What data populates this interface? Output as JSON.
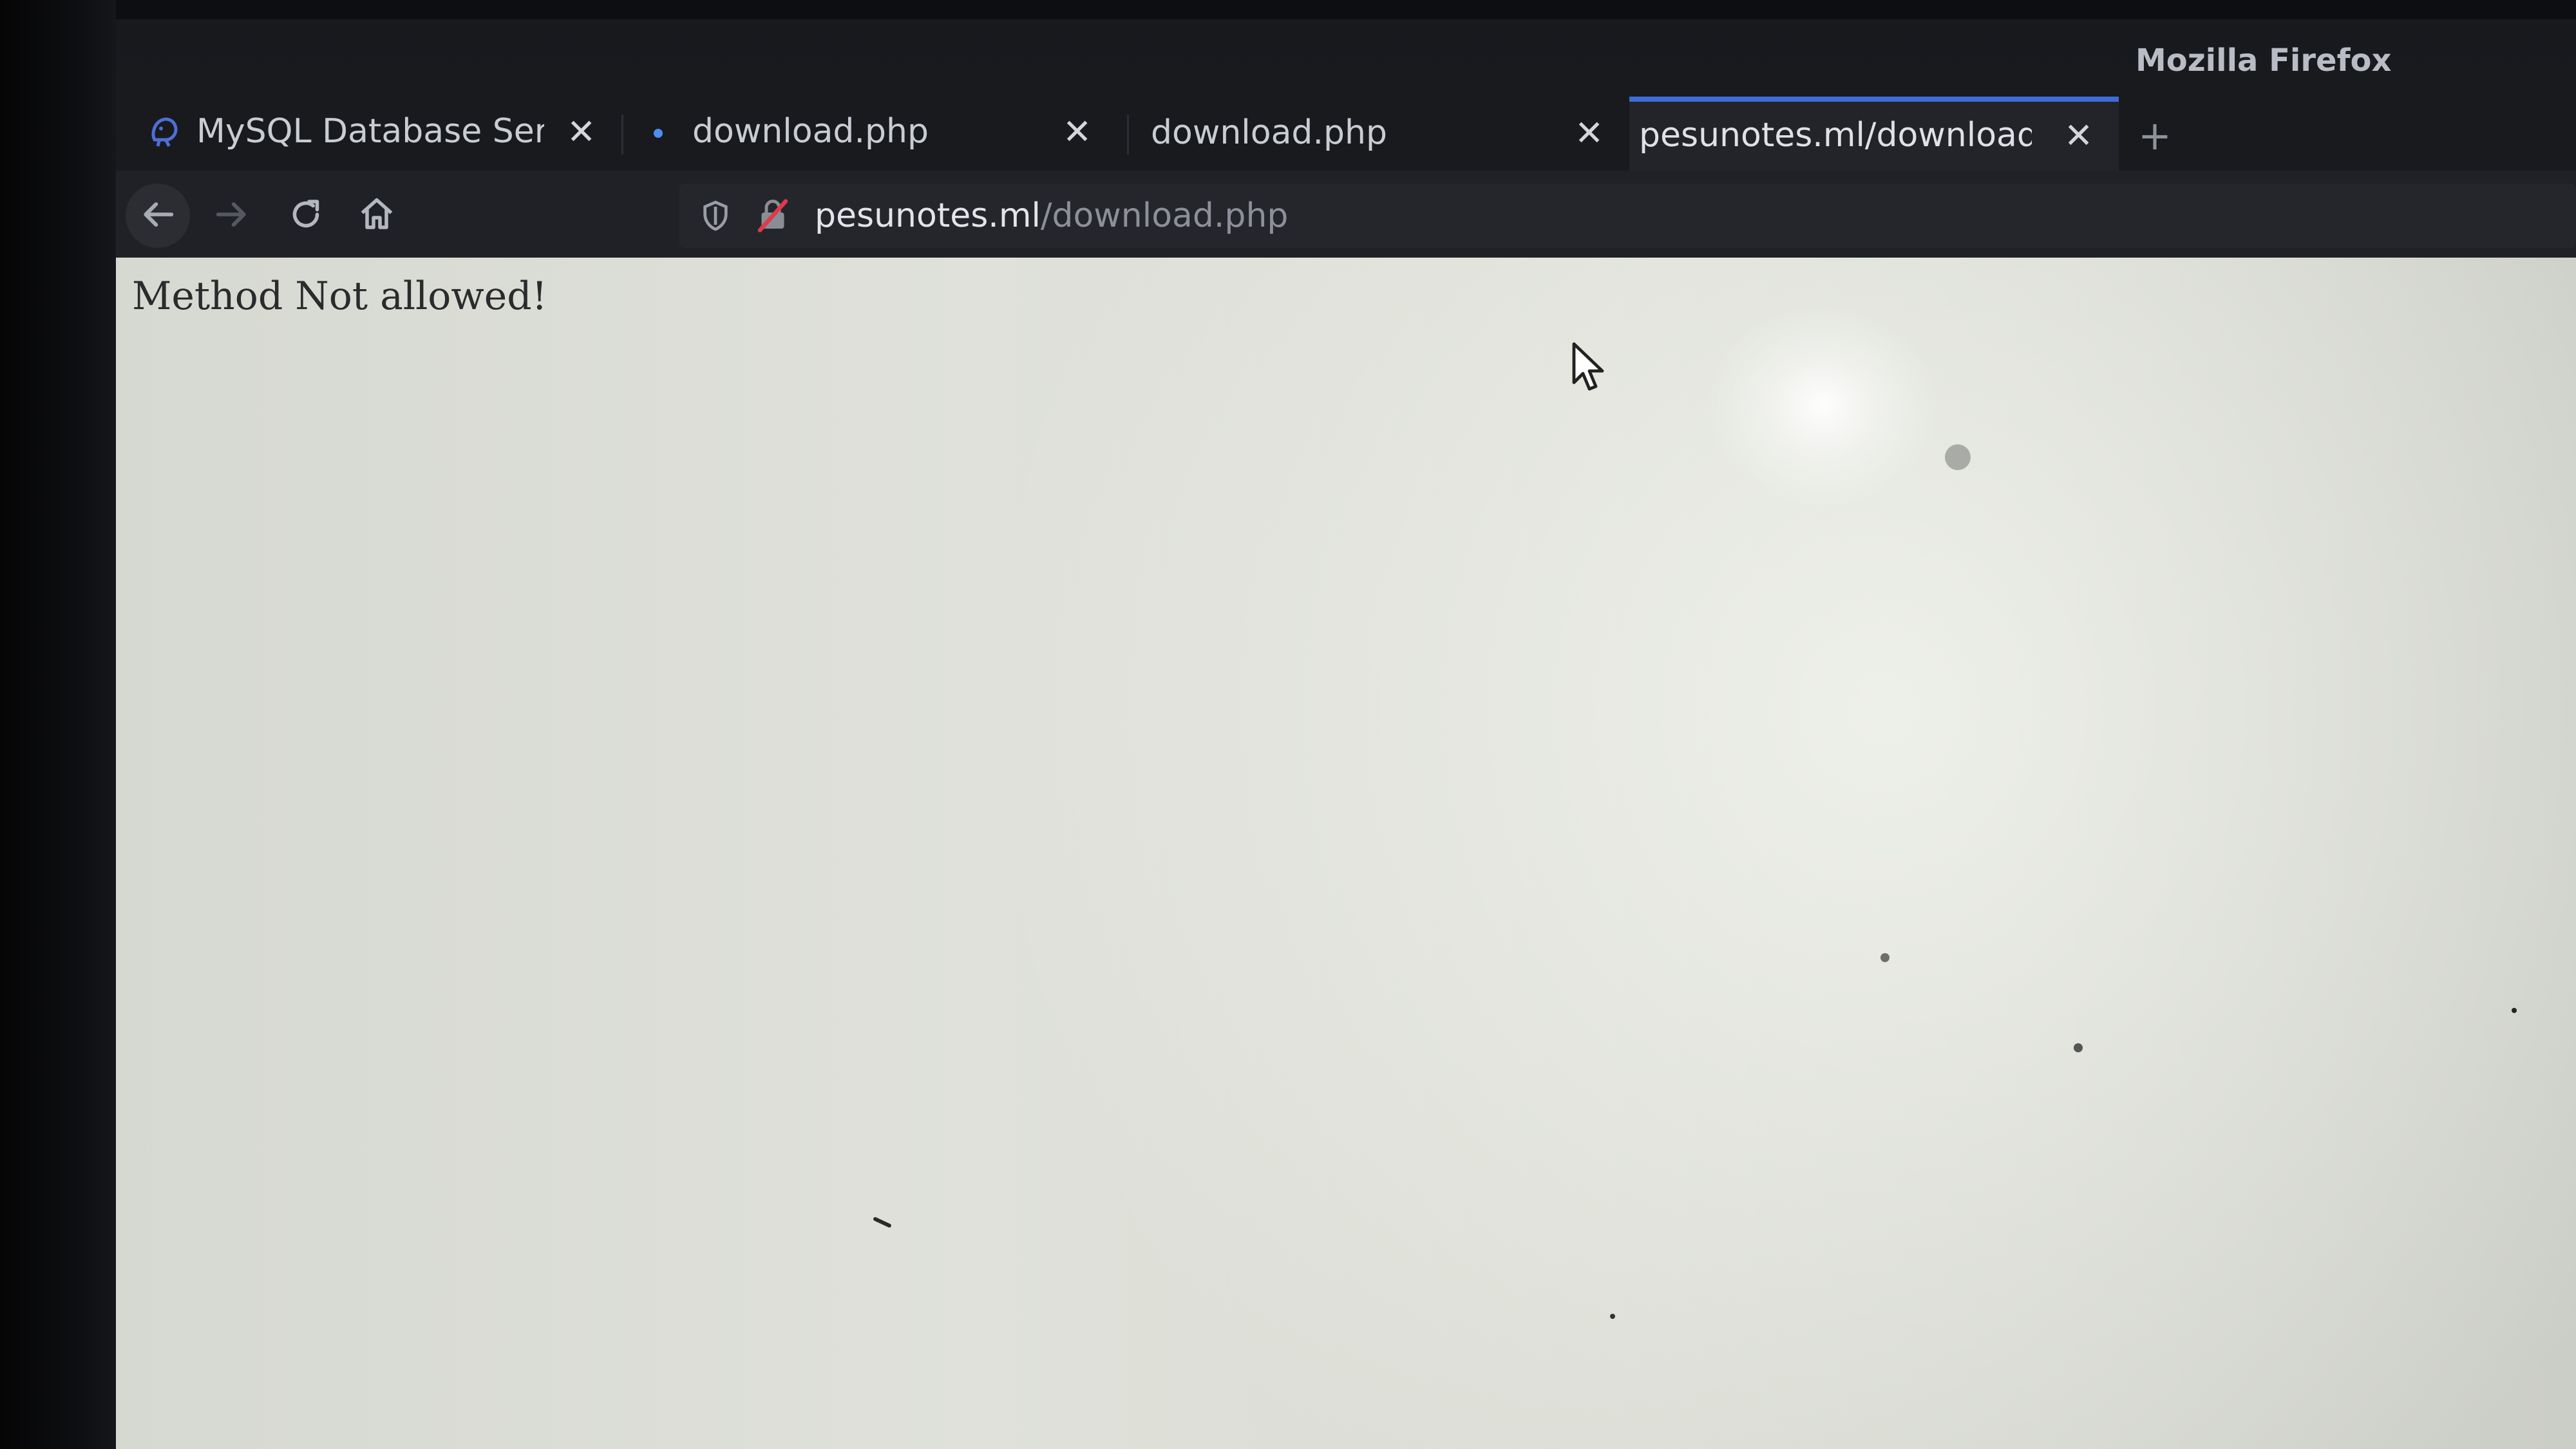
{
  "window": {
    "title": "Mozilla Firefox"
  },
  "tabs": [
    {
      "label": "MySQL Database Serve",
      "icon": "database-icon",
      "active": false
    },
    {
      "label": "download.php",
      "icon": "loading-dot-icon",
      "active": false
    },
    {
      "label": "download.php",
      "icon": "",
      "active": false
    },
    {
      "label": "pesunotes.ml/download.ph",
      "icon": "",
      "active": true
    }
  ],
  "tab_close_glyph": "✕",
  "new_tab_glyph": "+",
  "toolbar": {
    "back_icon": "back-arrow-icon",
    "forward_icon": "forward-arrow-icon",
    "reload_icon": "reload-icon",
    "home_icon": "home-icon"
  },
  "urlbar": {
    "host": "pesunotes.ml",
    "path": "/download.php",
    "shield_icon": "tracking-shield-icon",
    "insecure_icon": "insecure-lock-icon"
  },
  "page": {
    "message": "Method Not allowed!"
  },
  "colors": {
    "accent": "#3d6cd9",
    "page_background": "#dcded7",
    "chrome_background": "#1f2126"
  }
}
